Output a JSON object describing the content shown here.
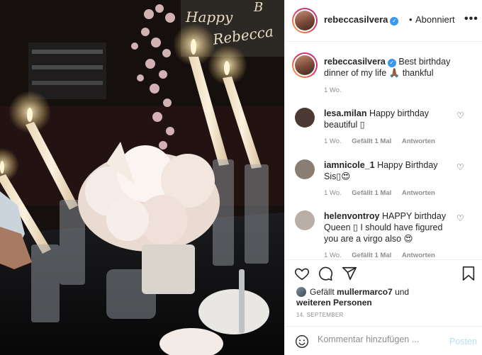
{
  "photo": {
    "sign_line1": "Happy",
    "sign_line2": "Rebecca",
    "sign_partial": "B"
  },
  "header": {
    "username": "rebeccasilvera",
    "separator": "•",
    "follow_status": "Abonniert",
    "more_icon": "more-horizontal-icon"
  },
  "caption": {
    "username": "rebeccasilvera",
    "text": "Best birthday dinner of my life 🙏🏾 thankful",
    "time": "1 Wo."
  },
  "comments": [
    {
      "username": "lesa.milan",
      "text": "Happy birthday beautiful ▯",
      "time": "1 Wo.",
      "likes": "Gefällt 1 Mal",
      "reply": "Antworten",
      "avatar_color": "#4a3a33"
    },
    {
      "username": "iamnicole_1",
      "text": "Happy Birthday Sis▯😍",
      "time": "1 Wo.",
      "likes": "Gefällt 1 Mal",
      "reply": "Antworten",
      "avatar_color": "#8a7d73"
    },
    {
      "username": "helenvontroy",
      "text": "HAPPY birthday Queen ▯ I should have figured you are a virgo also 😍",
      "time": "1 Wo.",
      "likes": "Gefällt 1 Mal",
      "reply": "Antworten",
      "avatar_color": "#b9aea8"
    }
  ],
  "actions": {
    "like_icon": "heart-icon",
    "comment_icon": "comment-icon",
    "share_icon": "send-icon",
    "save_icon": "bookmark-icon"
  },
  "likes": {
    "prefix": "Gefällt",
    "user": "mullermarco7",
    "connector": "und",
    "others": "weiteren Personen"
  },
  "date": "14. SEPTEMBER",
  "add_comment": {
    "emoji_icon": "smiley-icon",
    "placeholder": "Kommentar hinzufügen ...",
    "post_label": "Posten"
  }
}
